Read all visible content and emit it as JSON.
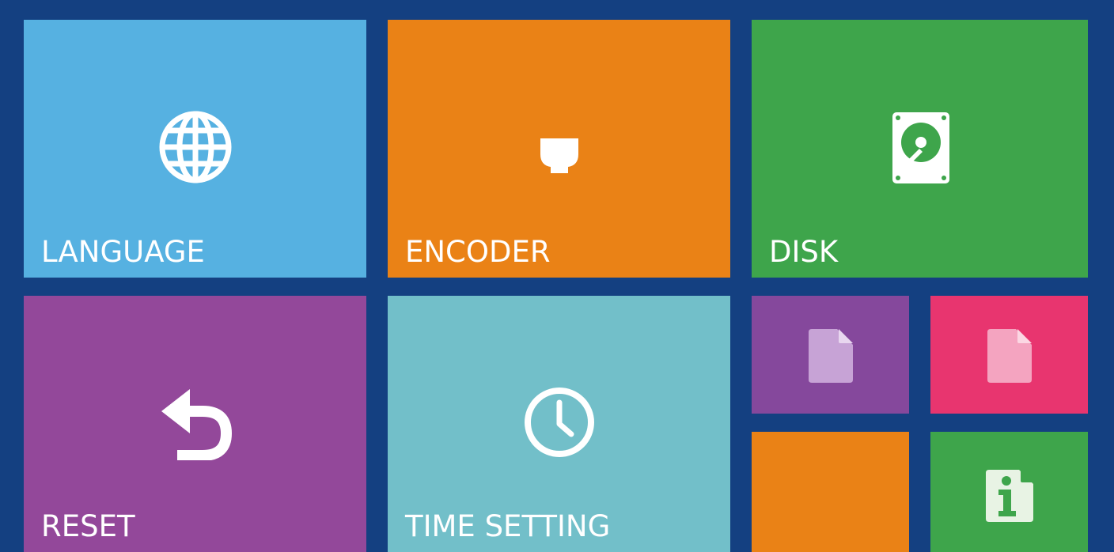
{
  "tiles": {
    "language": {
      "label": "LANGUAGE",
      "color": "#56b1e1",
      "icon": "globe-icon"
    },
    "encoder": {
      "label": "ENCODER",
      "color": "#ea8216",
      "icon": "camera-icon"
    },
    "disk": {
      "label": "DISK",
      "color": "#3ea54b",
      "icon": "hard-disk-icon"
    },
    "reset": {
      "label": "RESET",
      "color": "#93489a",
      "icon": "undo-icon"
    },
    "time": {
      "label": "TIME SETTING",
      "color": "#72bfc9",
      "icon": "clock-icon"
    },
    "small1": {
      "color": "#85489c",
      "icon": "document-icon"
    },
    "small2": {
      "color": "#e8356f",
      "icon": "document-icon"
    },
    "small3": {
      "color": "#ea8216"
    },
    "small4": {
      "color": "#3ea54b",
      "icon": "info-document-icon"
    }
  },
  "colors": {
    "background": "#144081"
  }
}
